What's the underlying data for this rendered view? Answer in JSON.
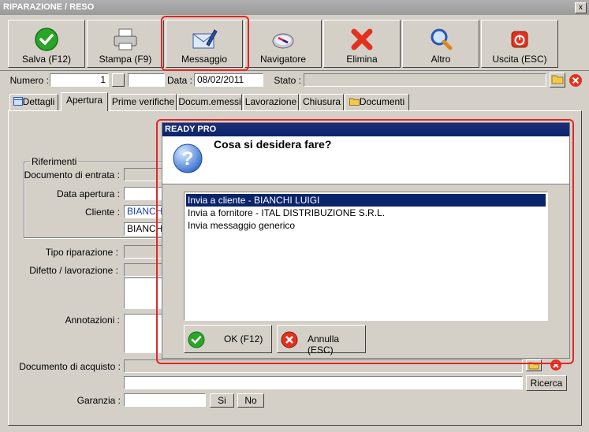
{
  "window": {
    "title": "RIPARAZIONE / RESO",
    "close_label": "x"
  },
  "toolbar": {
    "buttons": [
      {
        "label": "Salva (F12)",
        "icon": "check-icon"
      },
      {
        "label": "Stampa (F9)",
        "icon": "printer-icon"
      },
      {
        "label": "Messaggio",
        "icon": "envelope-pen-icon"
      },
      {
        "label": "Navigatore",
        "icon": "compass-icon"
      },
      {
        "label": "Elimina",
        "icon": "delete-x-icon"
      },
      {
        "label": "Altro",
        "icon": "magnifier-icon"
      },
      {
        "label": "Uscita (ESC)",
        "icon": "power-icon"
      }
    ]
  },
  "header": {
    "numero_label": "Numero :",
    "numero_value": "1",
    "data_label": "Data :",
    "data_value": "08/02/2011",
    "stato_label": "Stato :",
    "stato_value": ""
  },
  "tabs": [
    {
      "label": "Dettagli",
      "icon": "grid-icon"
    },
    {
      "label": "Apertura"
    },
    {
      "label": "Prime verifiche"
    },
    {
      "label": "Docum.emessi"
    },
    {
      "label": "Lavorazione"
    },
    {
      "label": "Chiusura"
    },
    {
      "label": "Documenti",
      "icon": "folder-icon"
    }
  ],
  "form": {
    "riferimenti_label": "Riferimenti",
    "documento_entrata_label": "Documento di entrata :",
    "data_apertura_label": "Data apertura :",
    "cliente_label": "Cliente :",
    "cliente_code": "BIANCHI",
    "cliente_name": "BIANCHI",
    "tipo_riparazione_label": "Tipo riparazione :",
    "difetto_label": "Difetto / lavorazione :",
    "annotazioni_label": "Annotazioni :",
    "documento_acquisto_label": "Documento di acquisto :",
    "ricerca_label": "Ricerca",
    "garanzia_label": "Garanzia :",
    "si_label": "Si",
    "no_label": "No"
  },
  "dialog": {
    "title": "READY PRO",
    "question": "Cosa si desidera fare?",
    "options": [
      "Invia a cliente - BIANCHI LUIGI",
      "Invia a fornitore - ITAL DISTRIBUZIONE S.R.L.",
      "Invia messaggio generico"
    ],
    "selected_index": 0,
    "ok_label": "OK (F12)",
    "cancel_label": "Annulla (ESC)"
  },
  "colors": {
    "highlight": "#e52525",
    "selection": "#0a246a",
    "dialog_title": "#0a246a"
  }
}
